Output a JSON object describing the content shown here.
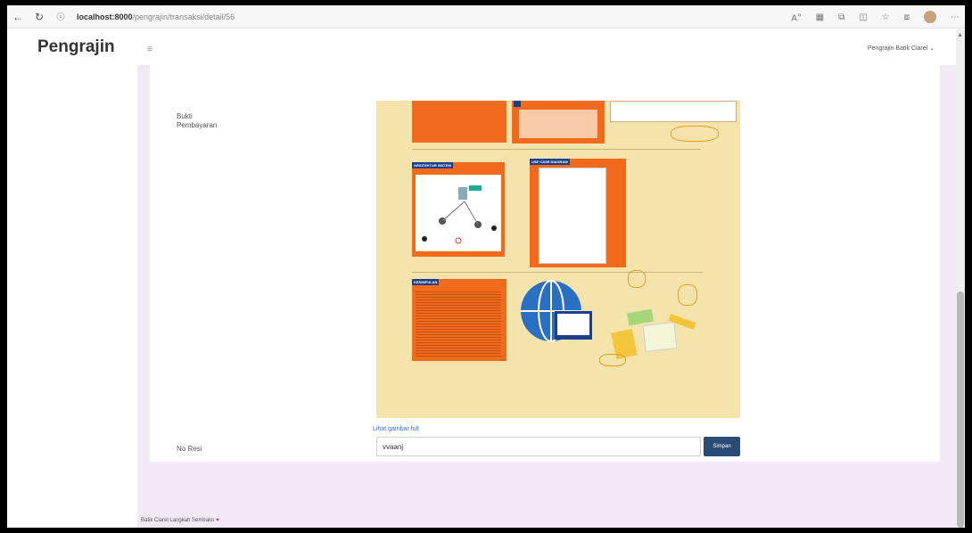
{
  "browser": {
    "url_host": "localhost:8000",
    "url_path": "/pengrajin/transaksi/detail/56"
  },
  "app": {
    "brand": "Pengrajin",
    "user_menu": "Pengrajin Batik Ciarel ⌄"
  },
  "form": {
    "bukti_label": "Bukti Pembayaran",
    "link_text": "Lihat gambar full",
    "resi_label": "No Resi",
    "resi_value": "vvaanj",
    "submit_label": "Simpan"
  },
  "poster": {
    "tags": [
      "ARSITEKTUR SISTEM",
      "USE CASE DIAGRAM",
      "KESIMPULAN"
    ]
  },
  "footer": {
    "text": "Batik Ciarel Langkah Sembako",
    "heart": "♥"
  }
}
